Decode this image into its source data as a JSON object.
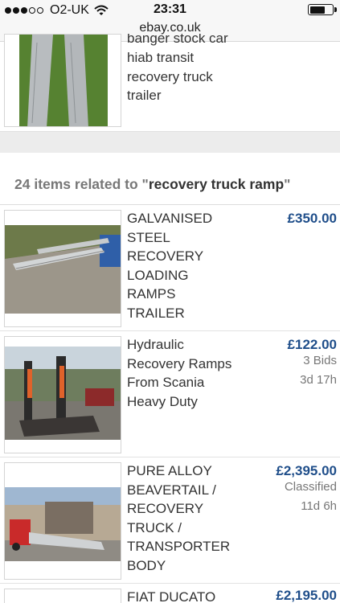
{
  "status_bar": {
    "carrier": "O2-UK",
    "time": "23:31",
    "signal_bars": 3,
    "battery_level": 0.7
  },
  "browser": {
    "url": "ebay.co.uk"
  },
  "top_listing": {
    "title_lines": [
      "banger stock car",
      "hiab transit",
      "recovery truck",
      "trailer"
    ]
  },
  "related": {
    "count_text": "24 items related to \"",
    "query": "recovery truck ramp",
    "close_quote": "\""
  },
  "listings": [
    {
      "title_lines": [
        "GALVANISED",
        "STEEL",
        "RECOVERY",
        "LOADING",
        "RAMPS",
        "TRAILER"
      ],
      "price": "£350.00",
      "meta": []
    },
    {
      "title_lines": [
        "Hydraulic",
        "Recovery Ramps",
        "From Scania",
        "Heavy Duty"
      ],
      "price": "£122.00",
      "meta": [
        "3 Bids",
        "3d 17h"
      ]
    },
    {
      "title_lines": [
        "PURE ALLOY",
        "BEAVERTAIL /",
        "RECOVERY",
        "TRUCK /",
        "TRANSPORTER",
        "BODY"
      ],
      "price": "£2,395.00",
      "meta": [
        "Classified",
        "11d 6h"
      ]
    },
    {
      "title_lines": [
        "FIAT DUCATO"
      ],
      "price": "£2,195.00",
      "meta": []
    }
  ],
  "colors": {
    "price": "#1f4e8a",
    "band": "#ececec"
  }
}
